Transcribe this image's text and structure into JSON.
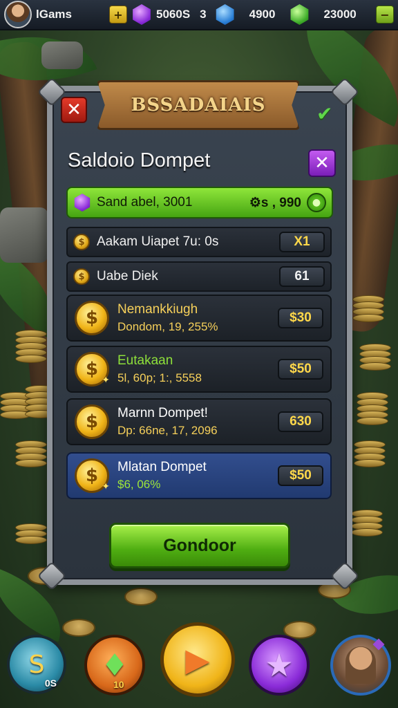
{
  "topbar": {
    "player_name": "lGams",
    "plus_symbol": "+",
    "gem_purple_value": "5060S",
    "separator": "3",
    "gem_blue_value": "4900",
    "gem_green_value": "23000",
    "colors": {
      "bar": "#1c232d",
      "plus": "#f2cf3a",
      "plus_green": "#8cc52a"
    }
  },
  "dialog": {
    "banner_title": "BSSADAIAIS",
    "title": "Saldoio Dompet",
    "close_symbol": "✕",
    "check_symbol": "✔",
    "balance": {
      "label": "Sand abel, 3001",
      "value": "⚙s , 990",
      "go_symbol": "●"
    },
    "rows_small": [
      {
        "label": "Aakam Uiapet 7u: 0s",
        "value": "X1"
      },
      {
        "label": "Uabe Diek",
        "value": "61"
      }
    ],
    "rows_large": [
      {
        "title": "Nemankkiugh",
        "subtitle": "Dondom, 19, 255%",
        "price": "$30"
      },
      {
        "title": "Eutakaan",
        "subtitle": "5l, 60p;  1:, 5558",
        "price": "$50"
      },
      {
        "title": "Marnn Dompet!",
        "subtitle": "Dp: 66ne, 17, 2096",
        "price": "630"
      },
      {
        "title": "Mlatan Dompet",
        "subtitle": "$6, 06%",
        "price": "$50"
      }
    ],
    "coin_glyph": "$",
    "confirm_label": "Gondoor",
    "colors": {
      "accent_green": "#5cc21a",
      "highlight_blue": "#2b4a8a",
      "gold_text": "#f6d05a"
    }
  },
  "bottom_nav": [
    {
      "icon": "swirl-rune-icon",
      "glyph": "S",
      "count": "0S"
    },
    {
      "icon": "green-gem-icon",
      "glyph": "♦",
      "count": "10"
    },
    {
      "icon": "play-arrow-icon",
      "glyph": "▶",
      "count": ""
    },
    {
      "icon": "star-icon",
      "glyph": "★",
      "count": ""
    },
    {
      "icon": "character-portrait-icon",
      "glyph": "",
      "count": ""
    }
  ]
}
